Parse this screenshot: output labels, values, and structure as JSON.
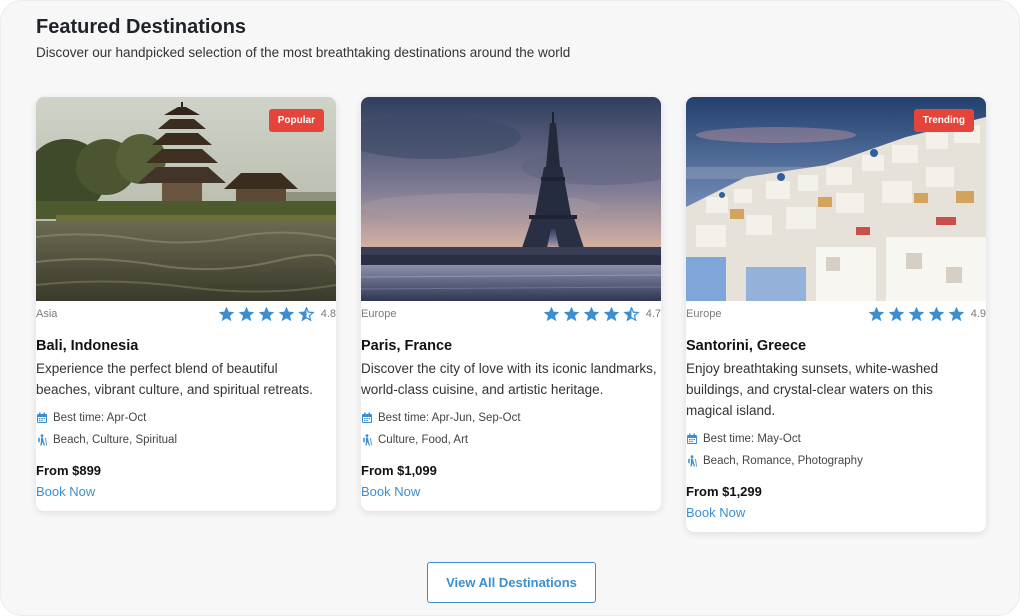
{
  "header": {
    "title": "Featured Destinations",
    "subtitle": "Discover our handpicked selection of the most breathtaking destinations around the world"
  },
  "colors": {
    "accent": "#3b8fd0",
    "badge": "#e5443a",
    "star": "#3b8fd0"
  },
  "icons": {
    "star": "star-icon",
    "half_star": "half-star-icon",
    "calendar": "calendar-icon",
    "activity": "hiking-icon"
  },
  "cards": [
    {
      "badge": "Popular",
      "region": "Asia",
      "rating": "4.8",
      "stars": 4.5,
      "name": "Bali, Indonesia",
      "description": "Experience the perfect blend of beautiful beaches, vibrant culture, and spiritual retreats.",
      "best_time": "Best time: Apr-Oct",
      "activities": "Beach, Culture, Spiritual",
      "price": "From $899",
      "cta": "Book Now"
    },
    {
      "badge": "",
      "region": "Europe",
      "rating": "4.7",
      "stars": 4.5,
      "name": "Paris, France",
      "description": "Discover the city of love with its iconic landmarks, world-class cuisine, and artistic heritage.",
      "best_time": "Best time: Apr-Jun, Sep-Oct",
      "activities": "Culture, Food, Art",
      "price": "From $1,099",
      "cta": "Book Now"
    },
    {
      "badge": "Trending",
      "region": "Europe",
      "rating": "4.9",
      "stars": 5,
      "name": "Santorini, Greece",
      "description": "Enjoy breathtaking sunsets, white-washed buildings, and crystal-clear waters on this magical island.",
      "best_time": "Best time: May-Oct",
      "activities": "Beach, Romance, Photography",
      "price": "From $1,299",
      "cta": "Book Now"
    }
  ],
  "footer": {
    "view_all": "View All Destinations"
  }
}
